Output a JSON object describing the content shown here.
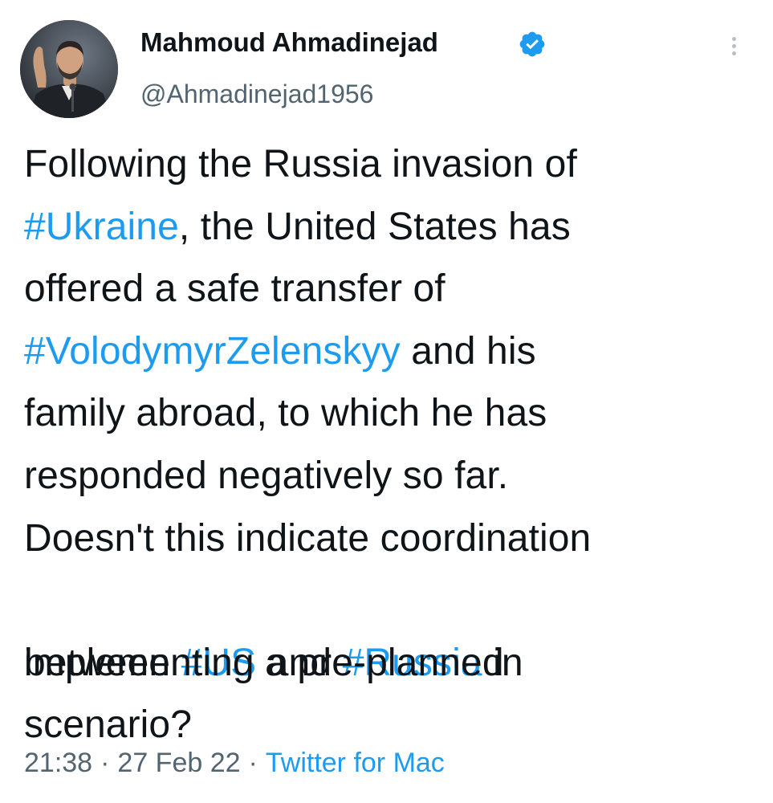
{
  "author": {
    "display_name": "Mahmoud Ahmadinejad",
    "handle": "@Ahmadinejad1956",
    "verified_icon": "verified-badge-icon",
    "avatar_icon": "profile-avatar"
  },
  "menu": {
    "icon": "more-options-icon"
  },
  "tweet": {
    "line1": {
      "t1": "Following the Russia invasion of"
    },
    "line2": {
      "h1": "#Ukraine",
      "t1": ", the United States has"
    },
    "line3": {
      "t1": "offered a safe transfer of"
    },
    "line4": {
      "h1": "#VolodymyrZelenskyy",
      "t1": " and his"
    },
    "line5": {
      "t1": "family abroad, to which he has"
    },
    "line6": {
      "t1": "responded negatively so far."
    },
    "line7": {
      "t1": "Doesn't this indicate coordination"
    },
    "line8": {
      "t1": "between ",
      "h1": "#US",
      "t2": " and ",
      "h2": "#Russia",
      "t3": " in"
    },
    "line9": {
      "t1": "implementing a pre-planned"
    },
    "line10": {
      "t1": "scenario?"
    }
  },
  "meta": {
    "time": "21:38",
    "separator": "·",
    "date": "27 Feb 22",
    "source": "Twitter for Mac"
  },
  "colors": {
    "link": "#1d9bf0",
    "text": "#0f1419",
    "secondary": "#536471"
  }
}
